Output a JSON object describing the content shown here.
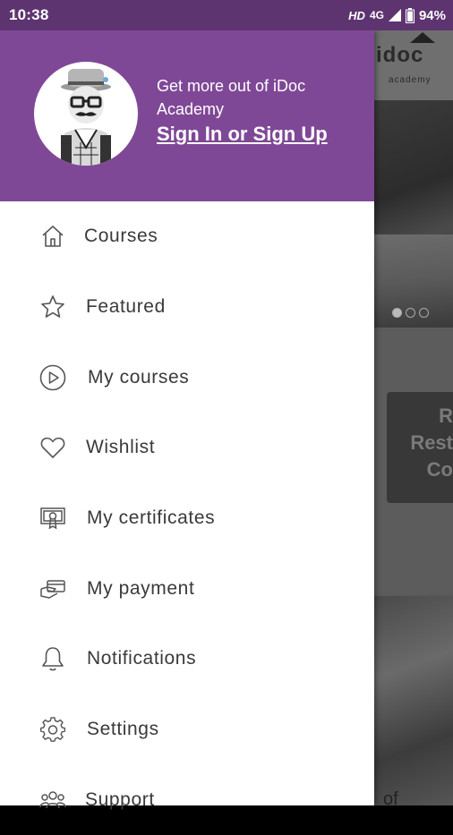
{
  "status_bar": {
    "time": "10:38",
    "network_hd": "HD",
    "network_4g": "4G",
    "battery": "94%"
  },
  "drawer": {
    "header": {
      "tagline": "Get more out of iDoc Academy",
      "signin_link": "Sign In or Sign Up",
      "avatar_icon": "hipster-avatar-icon"
    },
    "menu": [
      {
        "label": "Courses",
        "icon": "home-icon"
      },
      {
        "label": "Featured",
        "icon": "star-icon"
      },
      {
        "label": "My courses",
        "icon": "play-circle-icon"
      },
      {
        "label": "Wishlist",
        "icon": "heart-icon"
      },
      {
        "label": "My certificates",
        "icon": "certificate-icon"
      },
      {
        "label": "My payment",
        "icon": "payment-card-icon"
      },
      {
        "label": "Notifications",
        "icon": "bell-icon"
      },
      {
        "label": "Settings",
        "icon": "gear-icon"
      },
      {
        "label": "Support",
        "icon": "support-users-icon"
      }
    ]
  },
  "background_app": {
    "logo": "idoc",
    "logo_sub": "academy",
    "card_text_1": "R",
    "card_text_2": "Rest",
    "card_text_3": "Co",
    "bottom_text": "of"
  },
  "colors": {
    "header_purple": "#7f4896",
    "status_bar": "#5e3470",
    "menu_text": "#3a3a3a"
  }
}
